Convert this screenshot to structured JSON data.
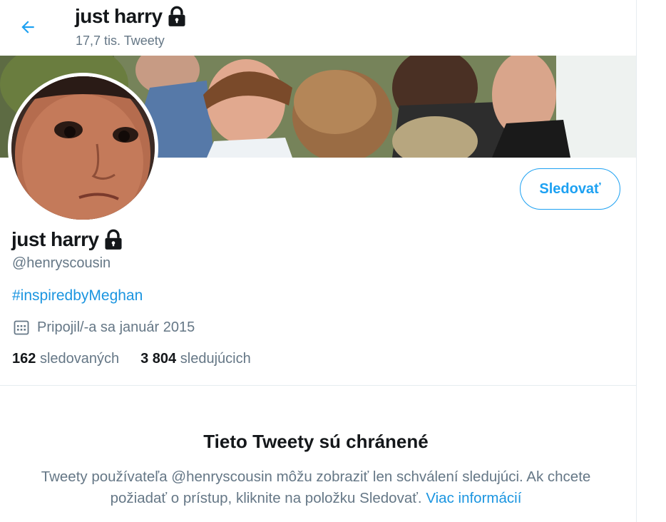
{
  "header": {
    "title": "just harry",
    "tweet_count": "17,7 tis. Tweety"
  },
  "profile": {
    "display_name": "just harry",
    "handle": "@henryscousin",
    "bio_link": "#inspiredbyMeghan",
    "joined": "Pripojil/-a sa január 2015",
    "following_count": "162",
    "following_label": "sledovaných",
    "followers_count": "3 804",
    "followers_label": "sledujúcich"
  },
  "actions": {
    "follow_label": "Sledovať"
  },
  "protected": {
    "title": "Tieto Tweety sú chránené",
    "text": "Tweety používateľa @henryscousin môžu zobraziť len schválení sledujúci. Ak chcete požiadať o prístup, kliknite na položku Sledovať.",
    "more_link": "Viac informácií"
  },
  "colors": {
    "accent": "#1da1f2",
    "link": "#1b95e0",
    "secondary_text": "#657786"
  },
  "icons": {
    "back": "arrow-left-icon",
    "lock": "lock-icon",
    "calendar": "calendar-icon"
  }
}
